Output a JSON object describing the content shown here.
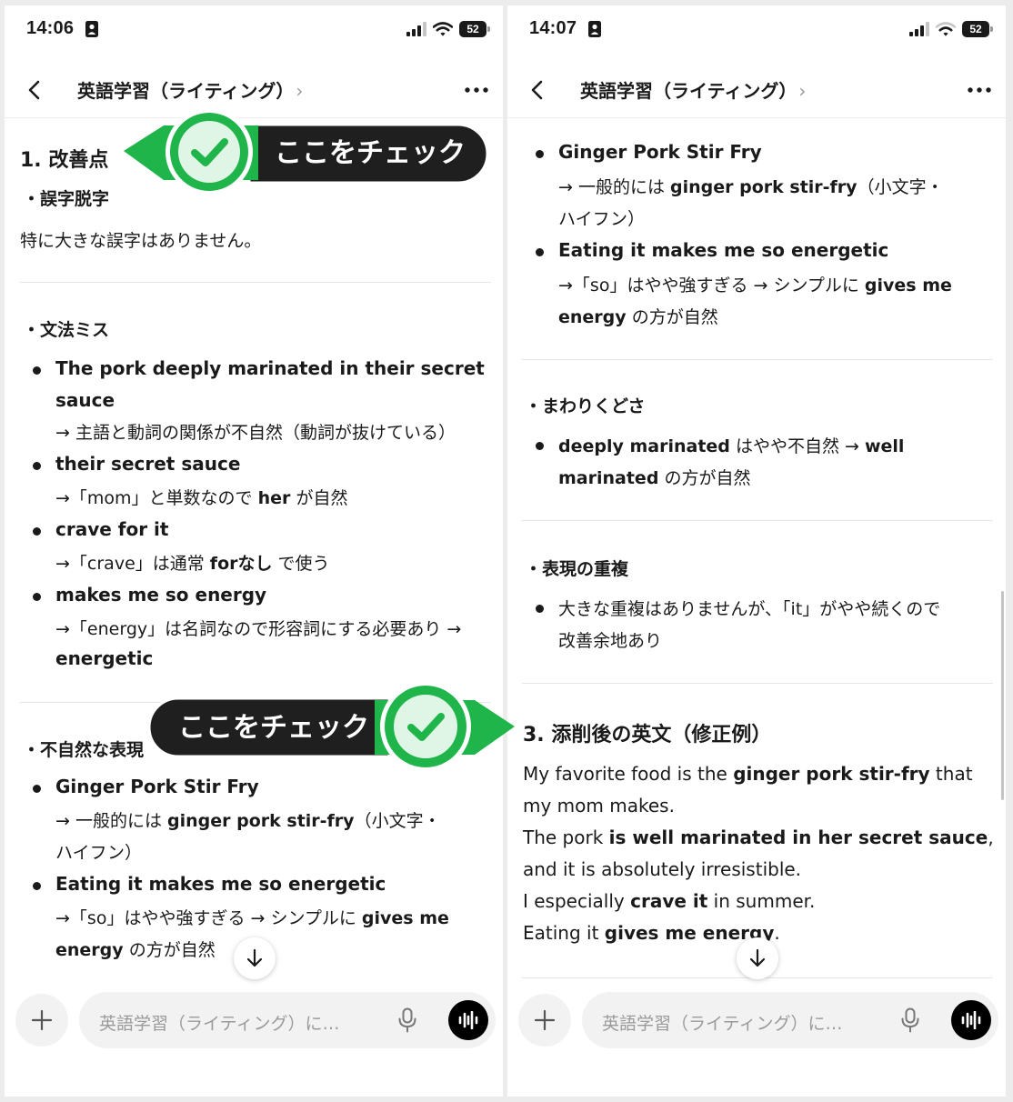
{
  "left": {
    "status": {
      "time": "14:06",
      "battery": "52"
    },
    "nav": {
      "title": "英語学習（ライティング）",
      "chevron": "›"
    },
    "section1_title": "1. 改善点",
    "typo_label": "・誤字脱字",
    "typo_text": "特に大きな誤字はありません。",
    "grammar_label": "・文法ミス",
    "grammar_items": [
      {
        "title_line1": "The pork deeply marinated in their secret",
        "title_line2": "sauce",
        "note_line1": "→ 主語と動詞の関係が不自然（動詞が抜けている）"
      },
      {
        "title": "their secret sauce",
        "note_pre": "→「mom」と単数なので ",
        "note_bold": "her",
        "note_post": " が自然"
      },
      {
        "title": "crave for it",
        "note_pre": "→「crave」は通常 ",
        "note_bold": "forなし",
        "note_post": " で使う"
      },
      {
        "title": "makes me so energy",
        "note_line1": "→「energy」は名詞なので形容詞にする必要あり →",
        "note_line2": "energetic"
      }
    ],
    "natural_label": "・不自然な表現",
    "natural_items": [
      {
        "title": "Ginger Pork Stir Fry",
        "note_pre": "→ 一般的には ",
        "note_bold": "ginger pork stir-fry",
        "note_post": "（小文字・",
        "note_line2": "ハイフン）"
      },
      {
        "title": "Eating it makes me so energetic",
        "note_pre": "→「so」はやや強すぎる → シンプルに ",
        "note_bold": "gives me",
        "note_line2_bold": "energy",
        "note_line2_post": " の方が自然"
      }
    ],
    "callout1": "ここをチェック",
    "callout2": "ここをチェック",
    "composer": {
      "placeholder": "英語学習（ライティング）に…"
    }
  },
  "right": {
    "status": {
      "time": "14:07",
      "battery": "52"
    },
    "nav": {
      "title": "英語学習（ライティング）",
      "chevron": "›"
    },
    "natural_items": [
      {
        "title": "Ginger Pork Stir Fry",
        "note_pre": "→ 一般的には ",
        "note_bold": "ginger pork stir-fry",
        "note_post": "（小文字・",
        "note_line2": "ハイフン）"
      },
      {
        "title": "Eating it makes me so energetic",
        "note_pre": "→「so」はやや強すぎる → シンプルに ",
        "note_bold": "gives me",
        "note_line2_bold": "energy",
        "note_line2_post": " の方が自然"
      }
    ],
    "awkward_label": "・まわりくどさ",
    "awkward_item": {
      "bold1": "deeply marinated",
      "mid": " はやや不自然 → ",
      "bold2": "well",
      "line2_bold": "marinated",
      "line2_post": " の方が自然"
    },
    "redundancy_label": "・表現の重複",
    "redundancy_item": {
      "line1": "大きな重複はありませんが、「it」がやや続くので",
      "line2": "改善余地あり"
    },
    "section3_title": "3. 添削後の英文（修正例）",
    "corrected": {
      "l1_pre": "My favorite food is the ",
      "l1_bold": "ginger pork stir-fry",
      "l1_post": " that",
      "l2": "my mom makes.",
      "l3_pre": "The pork ",
      "l3_bold": "is well marinated in her secret sauce",
      "l3_post": ",",
      "l4": "and it is absolutely irresistible.",
      "l5_pre": "I especially ",
      "l5_bold": "crave it",
      "l5_post": " in summer.",
      "l6_pre": "Eating it ",
      "l6_bold": "gives me energy",
      "l6_post": "."
    },
    "composer": {
      "placeholder": "英語学習（ライティング）に…"
    }
  },
  "colors": {
    "callout_bg": "#1f1f1f",
    "check_green": "#1fb54a",
    "check_light": "#dff5e6"
  }
}
